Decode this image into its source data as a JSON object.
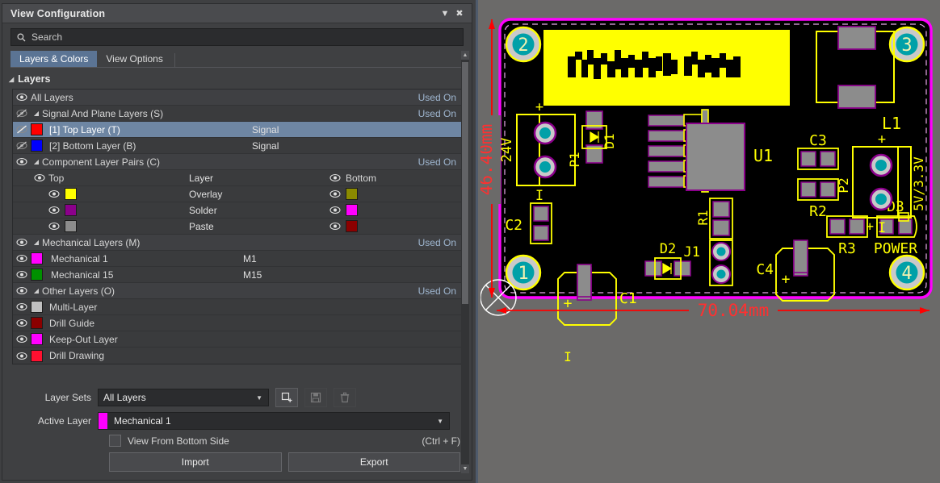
{
  "panel": {
    "title": "View Configuration",
    "collapse_icon": "chevron-down-icon",
    "close_icon": "close-icon",
    "search": {
      "placeholder": "Search",
      "value": "",
      "icon": "search-icon"
    },
    "tabs": [
      {
        "label": "Layers & Colors",
        "active": true
      },
      {
        "label": "View Options",
        "active": false
      }
    ],
    "layers_section": {
      "label": "Layers",
      "expanded": true
    }
  },
  "columns": {
    "layer": "Layer",
    "top": "Top",
    "bottom": "Bottom"
  },
  "used_on": "Used On",
  "rows": [
    {
      "id": "all-layers",
      "label": "All Layers",
      "indent": 0,
      "eye": "visible",
      "used": true
    },
    {
      "id": "signal-plane",
      "label": "Signal And Plane Layers (S)",
      "indent": 0,
      "eye": "hidden",
      "caret": true,
      "used": true
    },
    {
      "id": "top-layer",
      "label": "[1] Top Layer (T)",
      "indent": 1,
      "eye": "hidden",
      "color": "#ff0000",
      "type": "Signal",
      "selected": true
    },
    {
      "id": "bottom-layer",
      "label": "[2] Bottom Layer (B)",
      "indent": 1,
      "eye": "hidden",
      "color": "#0000ff",
      "type": "Signal"
    },
    {
      "id": "component-pairs",
      "label": "Component Layer Pairs (C)",
      "indent": 0,
      "eye": "visible",
      "caret": true,
      "used": true
    }
  ],
  "pair_header": {
    "top": "Top",
    "layer": "Layer",
    "bottom": "Bottom"
  },
  "pairs": [
    {
      "id": "overlay",
      "label": "Overlay",
      "top_color": "#ffff00",
      "bottom_color": "#8b8b00"
    },
    {
      "id": "solder",
      "label": "Solder",
      "top_color": "#8b008b",
      "bottom_color": "#ff00ff"
    },
    {
      "id": "paste",
      "label": "Paste",
      "top_color": "#8c8c8c",
      "bottom_color": "#8b0000"
    }
  ],
  "mech_group": {
    "label": "Mechanical Layers (M)",
    "used": true
  },
  "mech_layers": [
    {
      "id": "mechanical-1",
      "label": "Mechanical 1",
      "color": "#ff00ff",
      "short": "M1"
    },
    {
      "id": "mechanical-15",
      "label": "Mechanical 15",
      "color": "#009000",
      "short": "M15"
    }
  ],
  "other_group": {
    "label": "Other Layers (O)",
    "used": true
  },
  "other_layers": [
    {
      "id": "multi-layer",
      "label": "Multi-Layer",
      "color": "#c0c0c0"
    },
    {
      "id": "drill-guide",
      "label": "Drill Guide",
      "color": "#8b0000"
    },
    {
      "id": "keep-out-layer",
      "label": "Keep-Out Layer",
      "color": "#ff00ff"
    },
    {
      "id": "drill-drawing",
      "label": "Drill Drawing",
      "color": "#ff1030"
    }
  ],
  "form": {
    "layer_sets_label": "Layer Sets",
    "layer_sets_value": "All Layers",
    "active_layer_label": "Active Layer",
    "active_layer_value": "Mechanical 1",
    "active_layer_color": "#ff00ff",
    "new_set_icon": "add-layer-set-icon",
    "save_set_icon": "save-icon",
    "delete_set_icon": "trash-icon",
    "view_from_bottom_label": "View From Bottom Side",
    "view_from_bottom_checked": false,
    "view_from_bottom_shortcut": "(Ctrl + F)",
    "import_label": "Import",
    "export_label": "Export"
  },
  "pcb": {
    "width_dimension": "70.04mm",
    "height_dimension": "46.40mm",
    "board_fill": "#000000",
    "outline_color": "#ff00ff",
    "silkscreen_color": "#ffff00",
    "dimension_color": "#ff0000",
    "pad_color": "#8c8c8c",
    "solder_color": "#8b008b",
    "hole_color": "#00a0a8",
    "banner_color": "#ffff00",
    "mounting_holes": [
      "2",
      "3",
      "1",
      "4"
    ],
    "designators": [
      {
        "id": "L1",
        "label": "L1"
      },
      {
        "id": "U1",
        "label": "U1"
      },
      {
        "id": "P1",
        "label": "P1"
      },
      {
        "id": "P2",
        "label": "P2"
      },
      {
        "id": "D1",
        "label": "D1"
      },
      {
        "id": "D2",
        "label": "D2"
      },
      {
        "id": "D3",
        "label": "D3"
      },
      {
        "id": "C1",
        "label": "C1"
      },
      {
        "id": "C2",
        "label": "C2"
      },
      {
        "id": "C3",
        "label": "C3"
      },
      {
        "id": "C4",
        "label": "C4"
      },
      {
        "id": "R1",
        "label": "R1"
      },
      {
        "id": "R2",
        "label": "R2"
      },
      {
        "id": "R3",
        "label": "R3"
      },
      {
        "id": "J1",
        "label": "J1"
      }
    ],
    "annotations": [
      {
        "id": "v24",
        "label": "24V"
      },
      {
        "id": "v5-33",
        "label": "5V/3.3V"
      },
      {
        "id": "power",
        "label": "POWER"
      },
      {
        "id": "plus-p1",
        "label": "+"
      },
      {
        "id": "minus-p1",
        "label": "I"
      },
      {
        "id": "plus-p2",
        "label": "+"
      },
      {
        "id": "minus-p2",
        "label": "I"
      },
      {
        "id": "plus-c1",
        "label": "+"
      },
      {
        "id": "minus-c1",
        "label": "I"
      },
      {
        "id": "plus-c4",
        "label": "+"
      },
      {
        "id": "plus-d3",
        "label": "+"
      }
    ]
  }
}
